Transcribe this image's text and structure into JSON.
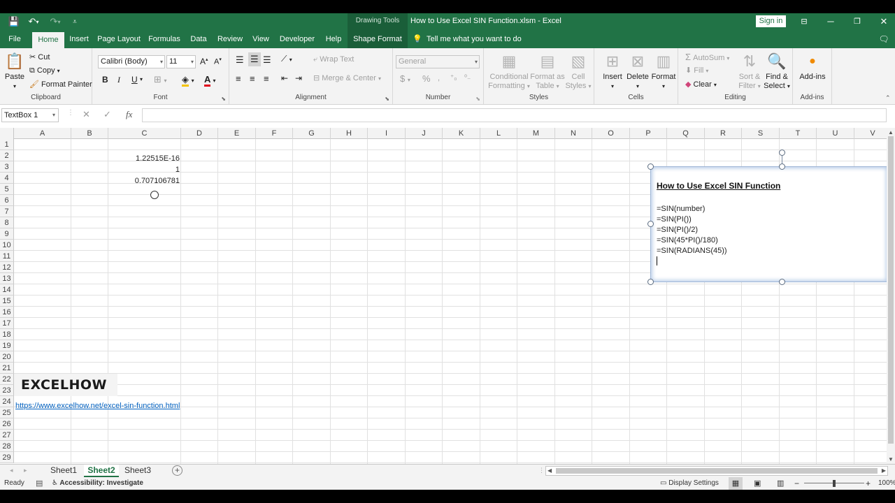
{
  "window": {
    "title": "How to Use Excel SIN Function.xlsm  -  Excel",
    "context_tab": "Drawing Tools",
    "signin": "Sign in"
  },
  "tabs": {
    "file": "File",
    "home": "Home",
    "insert": "Insert",
    "page_layout": "Page Layout",
    "formulas": "Formulas",
    "data": "Data",
    "review": "Review",
    "view": "View",
    "developer": "Developer",
    "help": "Help",
    "shape_format": "Shape Format",
    "tell_me": "Tell me what you want to do"
  },
  "ribbon": {
    "clipboard": {
      "label": "Clipboard",
      "paste": "Paste",
      "cut": "Cut",
      "copy": "Copy",
      "format_painter": "Format Painter"
    },
    "font": {
      "label": "Font",
      "name": "Calibri (Body)",
      "size": "11",
      "bold": "B",
      "italic": "I",
      "underline": "U"
    },
    "alignment": {
      "label": "Alignment",
      "wrap_text": "Wrap Text",
      "merge_center": "Merge & Center"
    },
    "number": {
      "label": "Number",
      "format": "General",
      "currency": "$",
      "percent": "%"
    },
    "styles": {
      "label": "Styles",
      "conditional_1": "Conditional",
      "conditional_2": "Formatting",
      "format_table_1": "Format as",
      "format_table_2": "Table",
      "cell_styles_1": "Cell",
      "cell_styles_2": "Styles"
    },
    "cells": {
      "label": "Cells",
      "insert": "Insert",
      "delete": "Delete",
      "format": "Format"
    },
    "editing": {
      "label": "Editing",
      "autosum": "AutoSum",
      "fill": "Fill",
      "clear": "Clear",
      "sort_1": "Sort &",
      "sort_2": "Filter",
      "find_1": "Find &",
      "find_2": "Select"
    },
    "addins": {
      "label": "Add-ins",
      "addins": "Add-ins"
    }
  },
  "formula_bar": {
    "name_box": "TextBox 1",
    "fx": "fx",
    "value": ""
  },
  "columns": [
    "A",
    "B",
    "C",
    "D",
    "E",
    "F",
    "G",
    "H",
    "I",
    "J",
    "K",
    "L",
    "M",
    "N",
    "O",
    "P",
    "Q",
    "R",
    "S",
    "T",
    "U",
    "V"
  ],
  "rows": [
    "1",
    "2",
    "3",
    "4",
    "5",
    "6",
    "7",
    "8",
    "9",
    "10",
    "11",
    "12",
    "13",
    "14",
    "15",
    "16",
    "17",
    "18",
    "19",
    "20",
    "21",
    "22",
    "23",
    "24",
    "25",
    "26",
    "27",
    "28",
    "29"
  ],
  "cells": {
    "c1": "1.22515E-16",
    "c2": "1",
    "c3": "0.707106781"
  },
  "logo_text": "EXCELHOW",
  "link": "https://www.excelhow.net/excel-sin-function.html",
  "textbox": {
    "title": "How to Use Excel SIN Function",
    "lines": [
      "=SIN(number)",
      "=SIN(PI())",
      "=SIN(PI()/2)",
      "=SIN(45*PI()/180)",
      "=SIN(RADIANS(45))"
    ]
  },
  "sheets": {
    "s1": "Sheet1",
    "s2": "Sheet2",
    "s3": "Sheet3",
    "active": "Sheet2"
  },
  "status": {
    "ready": "Ready",
    "accessibility": "Accessibility: Investigate",
    "display_settings": "Display Settings",
    "zoom": "100%"
  },
  "colors": {
    "brand": "#217346",
    "link": "#0563c1"
  }
}
